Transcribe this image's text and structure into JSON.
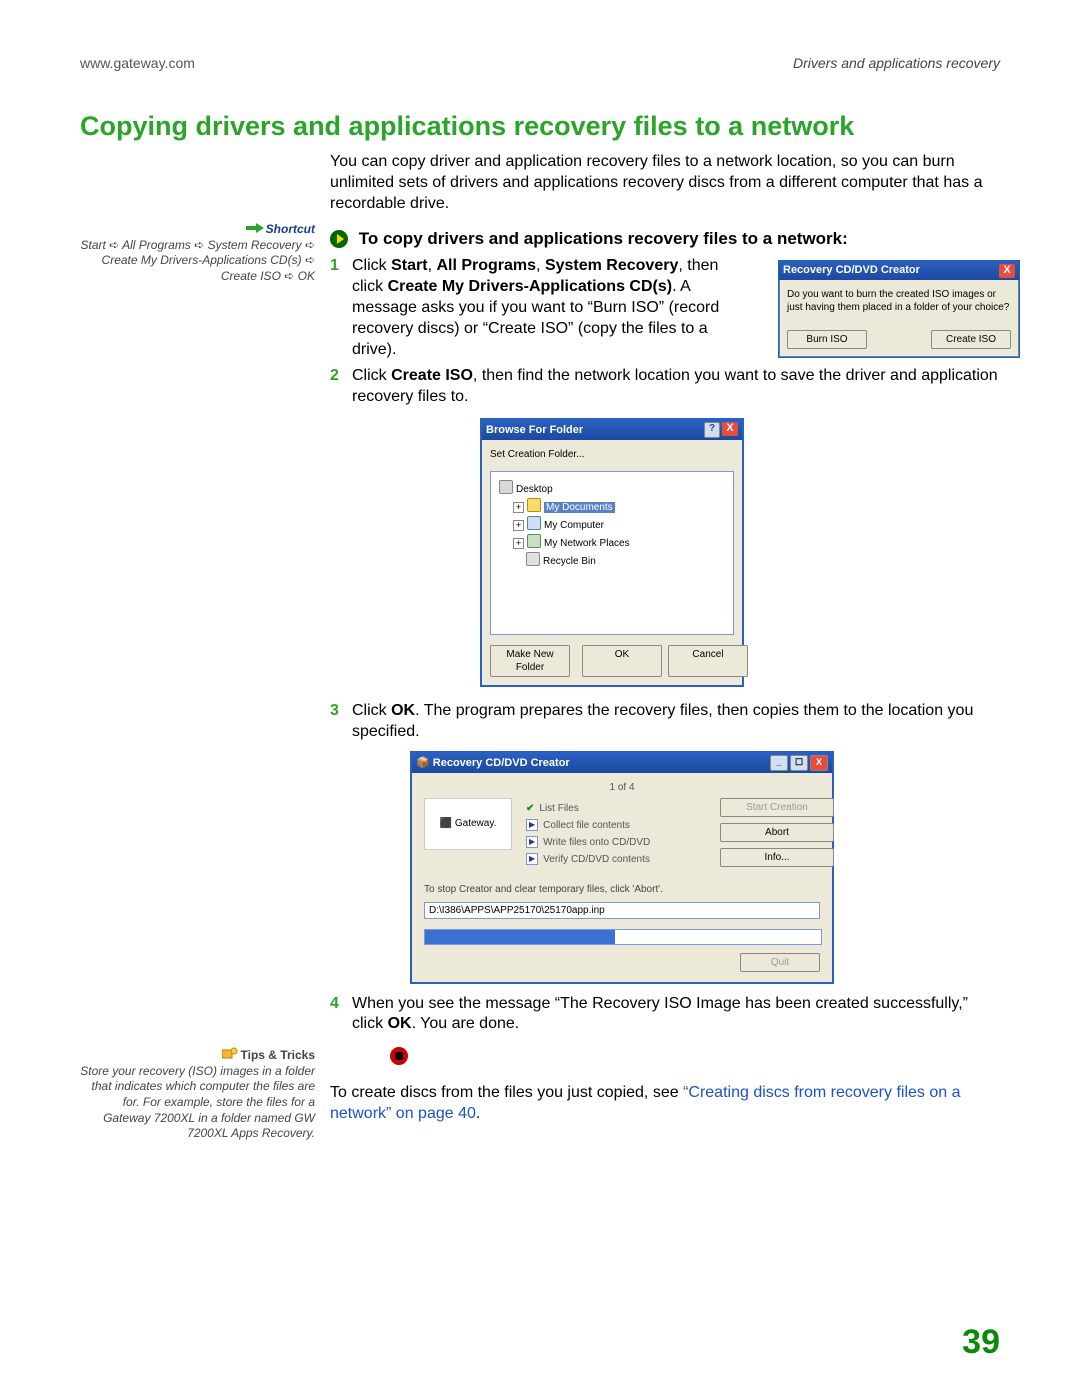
{
  "header": {
    "left": "www.gateway.com",
    "right": "Drivers and applications recovery"
  },
  "title": "Copying drivers and applications recovery files to a network",
  "intro": "You can copy driver and application recovery files to a network location, so you can burn unlimited sets of drivers and applications recovery discs from a different computer that has a recordable drive.",
  "subhead": "To copy drivers and applications recovery files to a network:",
  "sidebar": {
    "shortcut_label": "Shortcut",
    "shortcut_path": [
      "Start",
      "All Programs",
      "System Recovery",
      "Create My Drivers-Applications CD(s)",
      "Create ISO",
      "OK"
    ],
    "tips_label": "Tips & Tricks",
    "tips_text": "Store your recovery (ISO) images in a folder that indicates which computer the files are for. For example, store the files for a Gateway 7200XL in a folder named GW 7200XL Apps Recovery."
  },
  "steps": {
    "s1_a": "Click ",
    "s1_b1": "Start",
    "s1_c1": ", ",
    "s1_b2": "All Programs",
    "s1_c2": ", ",
    "s1_b3": "System Recovery",
    "s1_c3": ", then click ",
    "s1_b4": "Create My Drivers-Applications CD(s)",
    "s1_tail": ". A message asks you if you want to “Burn ISO” (record recovery discs) or “Create ISO” (copy the files to a drive).",
    "s2_a": "Click ",
    "s2_b": "Create ISO",
    "s2_tail": ", then find the network location you want to save the driver and application recovery files to.",
    "s3_a": "Click ",
    "s3_b": "OK",
    "s3_tail": ". The program prepares the recovery files, then copies them to the location you specified.",
    "s4_a": "When you see the message “The Recovery ISO Image has been created successfully,” click ",
    "s4_b": "OK",
    "s4_tail": ". You are done."
  },
  "closing": {
    "pre": "To create discs from the files you just copied, see ",
    "link": "“Creating discs from recovery files on a network” on page 40",
    "post": "."
  },
  "page_number": "39",
  "dialog1": {
    "title": "Recovery CD/DVD Creator",
    "text": "Do you want to burn the created ISO images or just having them placed in a folder of your choice?",
    "btn_burn": "Burn ISO",
    "btn_create": "Create ISO"
  },
  "dialog2": {
    "title": "Browse For Folder",
    "subtitle": "Set Creation Folder...",
    "tree": {
      "desktop": "Desktop",
      "docs": "My Documents",
      "comp": "My Computer",
      "net": "My Network Places",
      "bin": "Recycle Bin"
    },
    "btn_new": "Make New Folder",
    "btn_ok": "OK",
    "btn_cancel": "Cancel"
  },
  "dialog3": {
    "title": "Recovery CD/DVD Creator",
    "count": "1 of 4",
    "logo": "Gateway.",
    "step_list": "List Files",
    "step_collect": "Collect file contents",
    "step_write": "Write files onto CD/DVD",
    "step_verify": "Verify CD/DVD contents",
    "btn_start": "Start Creation",
    "btn_abort": "Abort",
    "btn_info": "Info...",
    "note": "To stop Creator and clear temporary files, click 'Abort'.",
    "path": "D:\\I386\\APPS\\APP25170\\25170app.inp",
    "btn_quit": "Quit"
  }
}
